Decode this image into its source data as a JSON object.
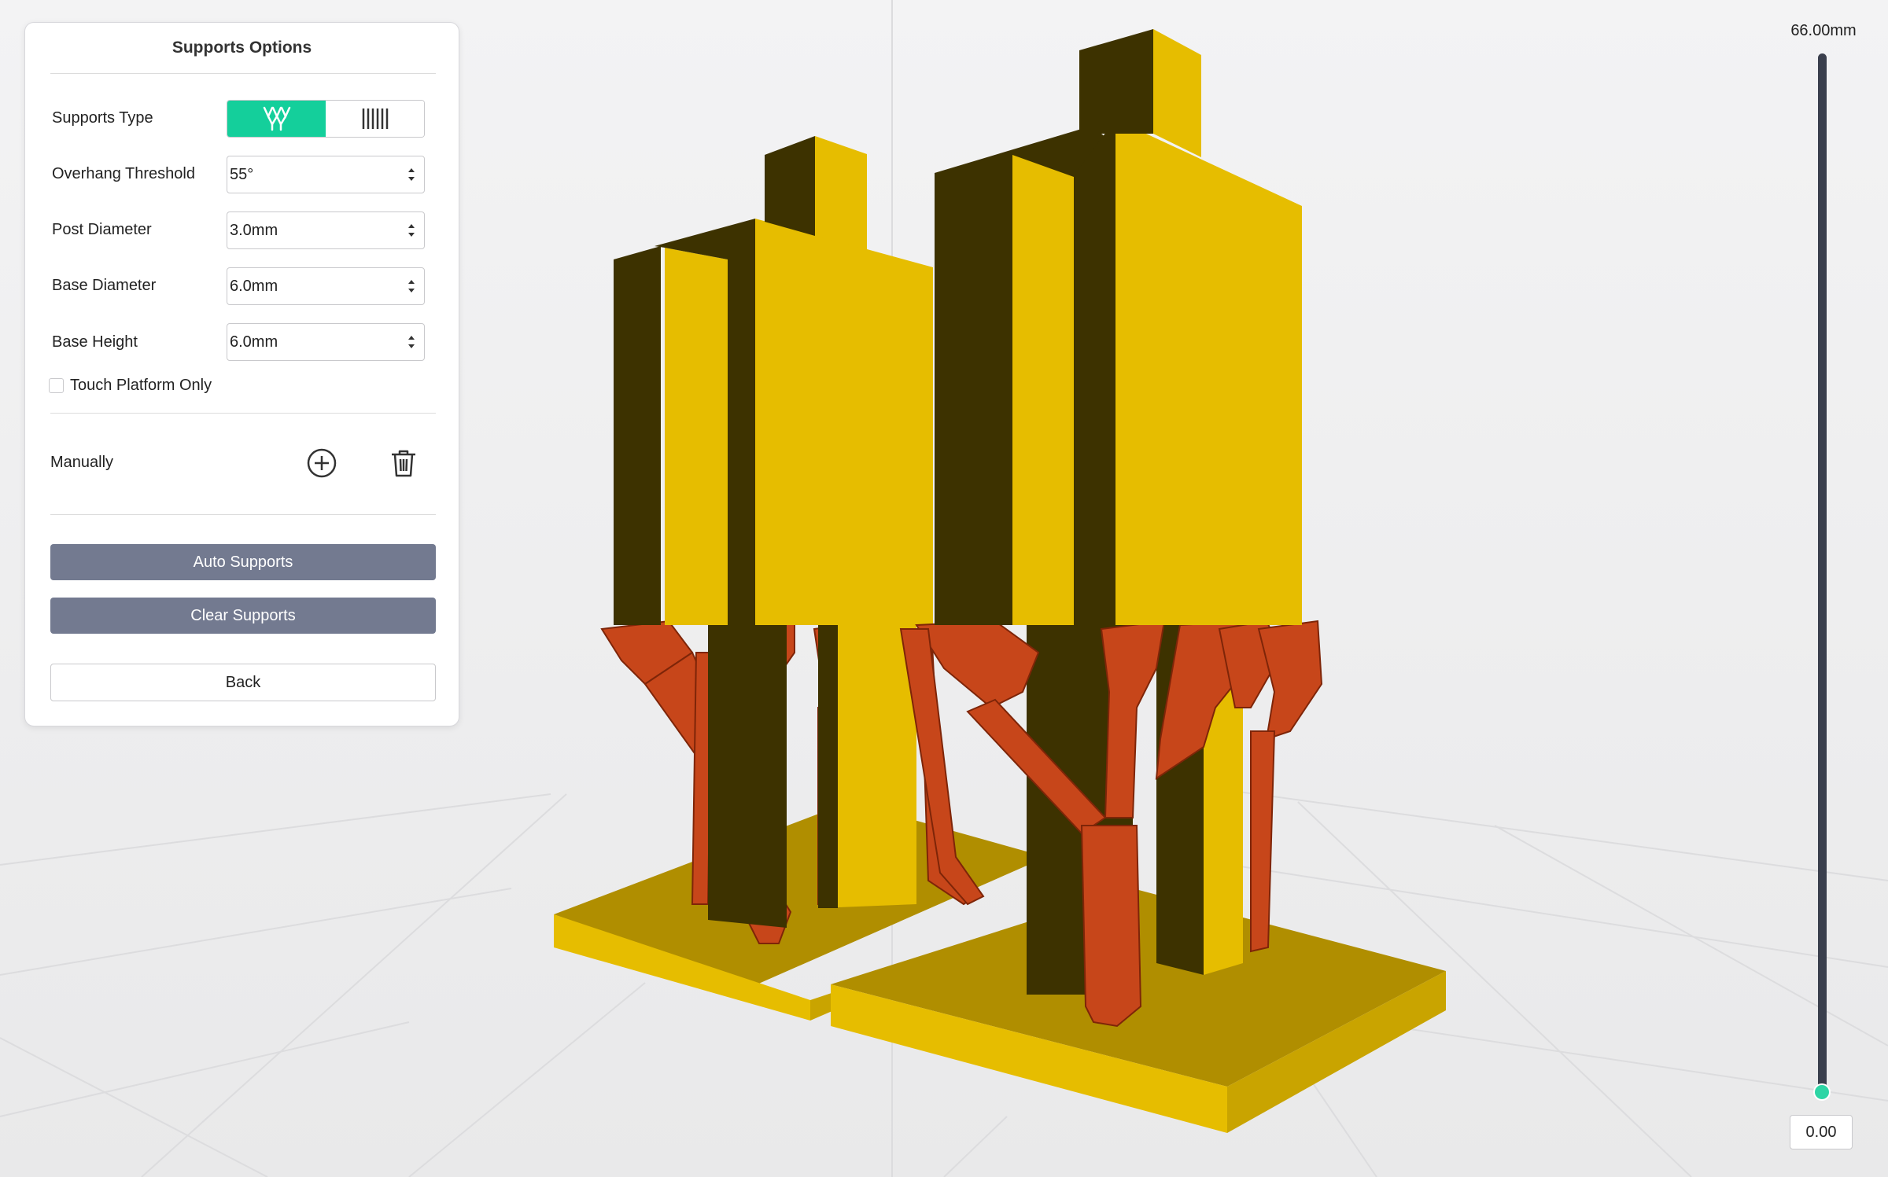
{
  "panel": {
    "title": "Supports Options",
    "supports_type": {
      "label": "Supports Type",
      "options": [
        {
          "name": "tree",
          "icon": "tree-supports-icon",
          "active": true
        },
        {
          "name": "linear",
          "icon": "linear-supports-icon",
          "active": false
        }
      ]
    },
    "overhang_threshold": {
      "label": "Overhang Threshold",
      "value": "55°"
    },
    "post_diameter": {
      "label": "Post Diameter",
      "value": "3.0mm"
    },
    "base_diameter": {
      "label": "Base Diameter",
      "value": "6.0mm"
    },
    "base_height": {
      "label": "Base Height",
      "value": "6.0mm"
    },
    "touch_platform": {
      "label": "Touch Platform Only",
      "checked": false
    },
    "manually": {
      "label": "Manually",
      "add_icon": "add-circle-icon",
      "delete_icon": "trash-icon"
    },
    "auto_supports_label": "Auto Supports",
    "clear_supports_label": "Clear Supports",
    "back_label": "Back"
  },
  "layer_slider": {
    "max_label": "66.00mm",
    "current_value": "0.00"
  },
  "colors": {
    "accent": "#14cf9b",
    "button_dark": "#737a90",
    "model_yellow": "#e6bd00",
    "model_shadow": "#3f3300",
    "support_orange": "#c7461a",
    "background": "#f1f1f2"
  }
}
